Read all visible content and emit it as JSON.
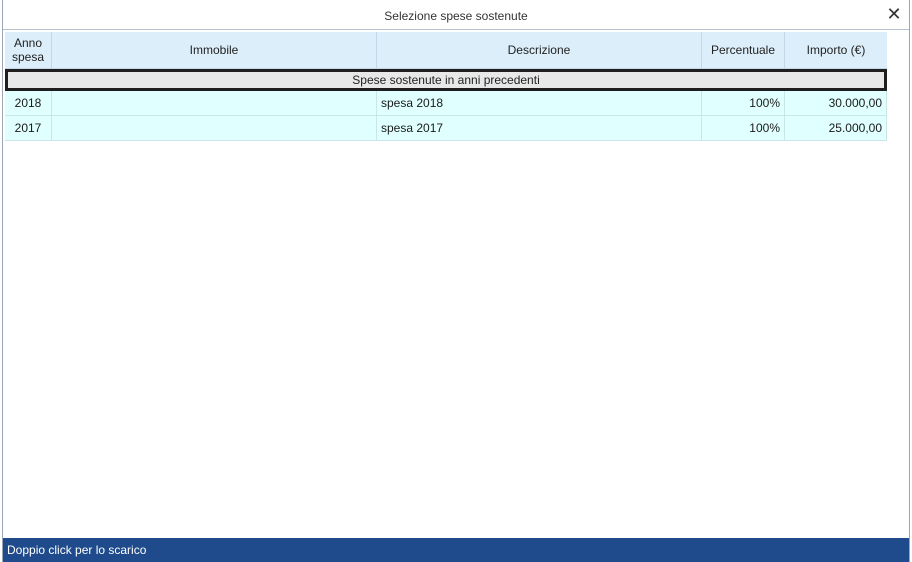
{
  "window": {
    "title": "Selezione spese sostenute"
  },
  "table": {
    "headers": [
      "Anno spesa",
      "Immobile",
      "Descrizione",
      "Percentuale",
      "Importo (€)"
    ],
    "header_anno_line1": "Anno",
    "header_anno_line2": "spesa",
    "group_label": "Spese sostenute in anni precedenti",
    "rows": [
      {
        "anno": "2018",
        "immobile": "",
        "descrizione": "spesa 2018",
        "percentuale": "100%",
        "importo": "30.000,00"
      },
      {
        "anno": "2017",
        "immobile": "",
        "descrizione": "spesa 2017",
        "percentuale": "100%",
        "importo": "25.000,00"
      }
    ]
  },
  "status": {
    "text": "Doppio click per lo scarico"
  },
  "colors": {
    "header_bg": "#dceefa",
    "row_bg": "#e0ffff",
    "status_bg": "#1f4b8c"
  }
}
